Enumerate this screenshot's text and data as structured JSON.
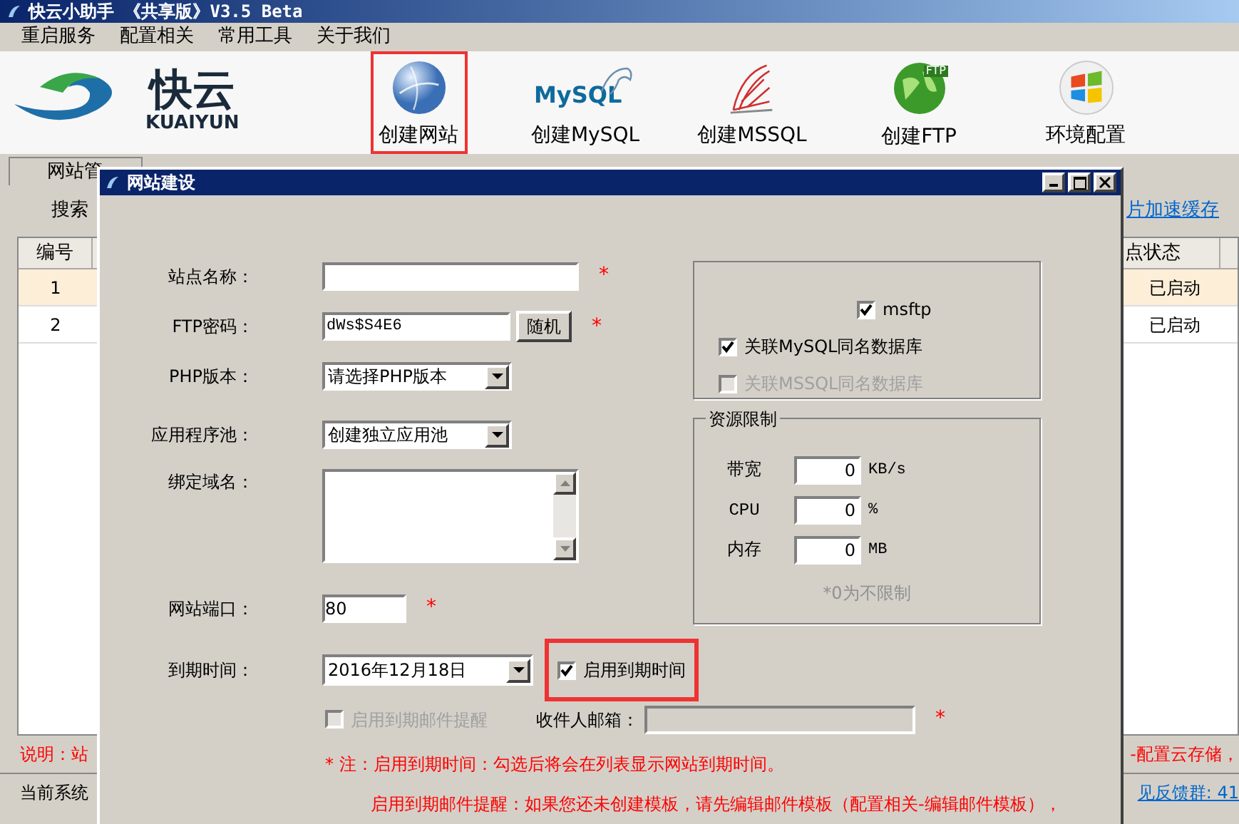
{
  "window": {
    "title": "快云小助手 《共享版》V3.5 Beta"
  },
  "menu": [
    "重启服务",
    "配置相关",
    "常用工具",
    "关于我们"
  ],
  "logo": {
    "name": "快云",
    "subtitle": "KUAIYUN"
  },
  "toolbar": [
    {
      "kind": "globe",
      "label": "创建网站",
      "highlighted": true
    },
    {
      "kind": "mysql",
      "label": "创建MySQL",
      "logo_text": "MySQL",
      "highlighted": false
    },
    {
      "kind": "mssql",
      "label": "创建MSSQL",
      "highlighted": false
    },
    {
      "kind": "ftp",
      "label": "创建FTP",
      "badge": "FTP",
      "highlighted": false
    },
    {
      "kind": "windows",
      "label": "环境配置",
      "highlighted": false
    }
  ],
  "main_tab": "网站管",
  "search_label": "搜索",
  "cache_link": "片加速缓存",
  "table": {
    "columns": [
      "编号",
      "点状态"
    ],
    "rows": [
      {
        "number": "1",
        "status": "已启动",
        "selected": true
      },
      {
        "number": "2",
        "status": "已启动",
        "selected": false
      }
    ]
  },
  "note_left": "说明：站",
  "note_right": "-配置云存储，",
  "status_bar": {
    "left": "当前系统",
    "link": "见反馈群: 41"
  },
  "dialog": {
    "title": "网站建设",
    "fields": [
      {
        "kind": "text",
        "label": "站点名称：",
        "mark": "*"
      },
      {
        "kind": "password",
        "label": "FTP密码：",
        "value": "dWs$S4E6",
        "button": "随机",
        "mark": "*"
      },
      {
        "kind": "select",
        "label": "PHP版本：",
        "value": "请选择PHP版本"
      },
      {
        "kind": "select",
        "label": "应用程序池：",
        "value": "创建独立应用池"
      },
      {
        "kind": "textarea",
        "label": "绑定域名："
      },
      {
        "kind": "short",
        "label": "网站端口：",
        "value": "80",
        "mark": "*"
      }
    ],
    "options": [
      {
        "label": "msftp",
        "checked": true,
        "disabled": false
      },
      {
        "label": "关联MySQL同名数据库",
        "checked": true,
        "disabled": false
      },
      {
        "label": "关联MSSQL同名数据库",
        "checked": false,
        "disabled": true
      }
    ],
    "resources": {
      "title": "资源限制",
      "rows": [
        {
          "label": "带宽",
          "value": "0",
          "unit": "KB/s"
        },
        {
          "label": "CPU",
          "value": "0",
          "unit": "%"
        },
        {
          "label": "内存",
          "value": "0",
          "unit": "MB"
        }
      ],
      "hint": "*0为不限制"
    },
    "expiry": {
      "label": "到期时间：",
      "value": "2016年12月18日",
      "checkbox": {
        "label": "启用到期时间",
        "checked": true,
        "highlighted": true
      }
    },
    "email": {
      "checkbox": {
        "label": "启用到期邮件提醒",
        "checked": false,
        "disabled": true
      },
      "label": "收件人邮箱：",
      "mark": "*"
    },
    "notes": [
      "* 注：启用到期时间：勾选后将会在列表显示网站到期时间。",
      "启用到期邮件提醒：如果您还未创建模板，请先编辑邮件模板（配置相关-编辑邮件模板），"
    ]
  }
}
